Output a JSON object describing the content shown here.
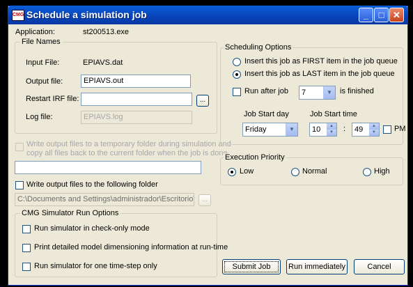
{
  "window": {
    "title": "Schedule a simulation job",
    "icon": "CMG",
    "minimize": "_",
    "maximize": "□",
    "close": "✕"
  },
  "application": {
    "label": "Application:",
    "value": "st200513.exe"
  },
  "file_names": {
    "legend": "File Names",
    "input_label": "Input File:",
    "input_value": "EPIAVS.dat",
    "output_label": "Output file:",
    "output_value": "EPIAVS.out",
    "restart_label": "Restart IRF file:",
    "restart_value": "",
    "browse": "...",
    "log_label": "Log file:",
    "log_value": "EPIAVS.log"
  },
  "temp_folder": {
    "label_line1": "Write output files to a temporary folder during simulation and",
    "label_line2": "copy all files back to the current folder when the job is done",
    "value": ""
  },
  "following_folder": {
    "label": "Write output files to the following folder",
    "value": "C:\\Documents and Settings\\administrador\\Escritorio\\EP",
    "browse": "..."
  },
  "run_options": {
    "legend": "CMG Simulator Run Options",
    "opt1": "Run simulator in check-only mode",
    "opt2": "Print detailed model dimensioning information at run-time",
    "opt3": "Run simulator for one time-step only"
  },
  "scheduling": {
    "legend": "Scheduling Options",
    "first": "Insert this job as FIRST item in the job queue",
    "last": "Insert this job as LAST item in the job queue",
    "run_after": "Run after job",
    "run_after_value": "7",
    "finished": "is finished",
    "start_day_label": "Job Start day",
    "start_day_value": "Friday",
    "start_time_label": "Job Start time",
    "hour": "10",
    "colon": ":",
    "minute": "49",
    "pm": "PM"
  },
  "priority": {
    "legend": "Execution Priority",
    "low": "Low",
    "normal": "Normal",
    "high": "High"
  },
  "buttons": {
    "submit": "Submit Job",
    "run": "Run immediately",
    "cancel": "Cancel"
  }
}
